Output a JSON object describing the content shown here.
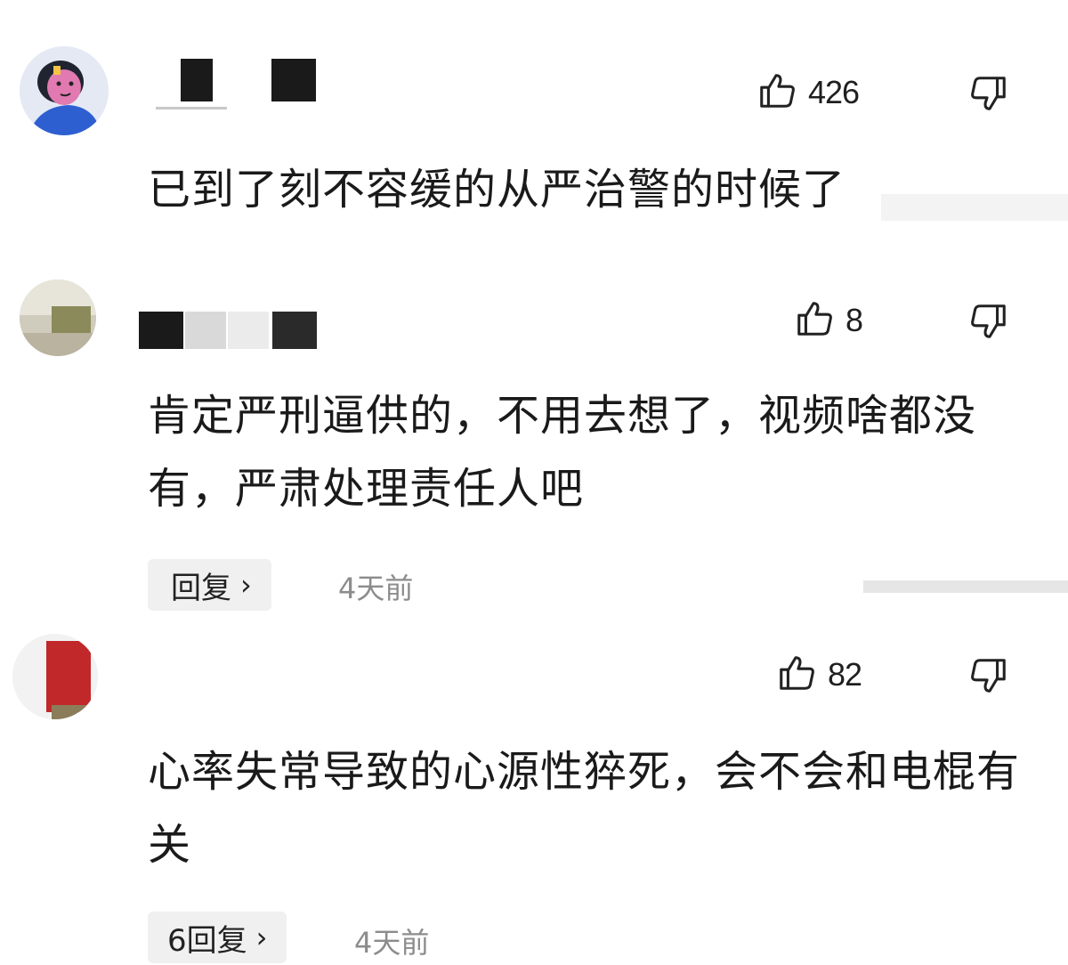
{
  "comments": [
    {
      "avatar": "avatar-cartoon-girl",
      "likes": "426",
      "text": "已到了刻不容缓的从严治警的时候了",
      "reply_label": "",
      "timestamp": ""
    },
    {
      "avatar": "avatar-photo-room",
      "likes": "8",
      "text": "肯定严刑逼供的，不用去想了，视频啥都没有，严肃处理责任人吧",
      "reply_label": "回复",
      "timestamp": "4天前"
    },
    {
      "avatar": "avatar-photo-red",
      "likes": "82",
      "text": "心率失常导致的心源性猝死，会不会和电棍有关",
      "reply_label": "6回复",
      "timestamp": "4天前"
    }
  ],
  "icons": {
    "like": "thumbs-up-icon",
    "dislike": "thumbs-down-icon",
    "reply_chevron": "chevron-right-icon"
  },
  "colors": {
    "text": "#1a1a1a",
    "timestamp": "#8c8c8c",
    "reply_bg": "#f0f0f0"
  }
}
